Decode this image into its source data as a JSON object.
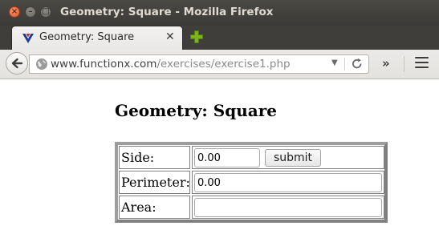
{
  "window": {
    "title": "Geometry: Square - Mozilla Firefox"
  },
  "tab": {
    "title": "Geometry: Square"
  },
  "address": {
    "host": "www.functionx.com",
    "path": "/exercises/exercise1.php"
  },
  "page": {
    "heading": "Geometry: Square",
    "rows": [
      {
        "label": "Side:",
        "value": "0.00",
        "button": "submit"
      },
      {
        "label": "Perimeter:",
        "value": "0.00"
      },
      {
        "label": "Area:",
        "value": ""
      }
    ]
  },
  "icons": {
    "close": "close-icon",
    "minimize": "minimize-icon",
    "maximize": "maximize-icon",
    "favicon": "functionx-favicon-icon",
    "tab_close": "tab-close-icon",
    "new_tab": "plus-icon",
    "back": "back-arrow-icon",
    "globe": "globe-icon",
    "dropdown": "chevron-down-icon",
    "reload": "reload-icon",
    "overflow": "double-chevron-right-icon",
    "menu": "hamburger-menu-icon"
  },
  "colors": {
    "titlebar": "#3b3a36",
    "close_button": "#e0542a",
    "plus": "#7ab51d",
    "favicon_blue": "#1b3d9c",
    "favicon_red": "#d11f1f"
  }
}
